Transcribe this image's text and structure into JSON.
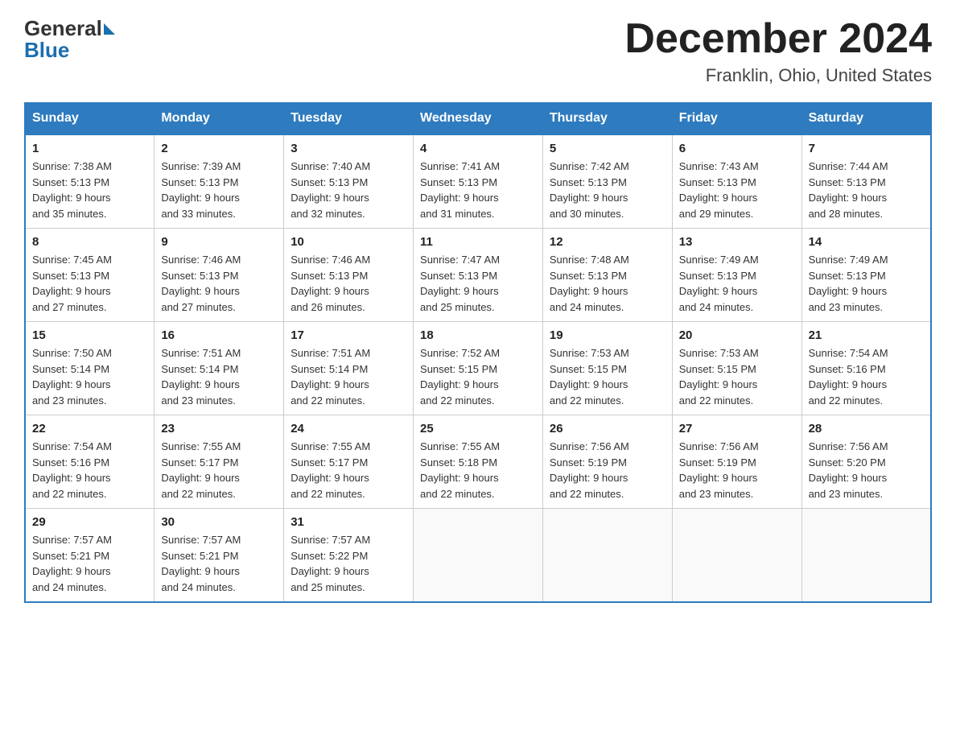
{
  "logo": {
    "general": "General",
    "blue": "Blue"
  },
  "title": "December 2024",
  "subtitle": "Franklin, Ohio, United States",
  "days": [
    "Sunday",
    "Monday",
    "Tuesday",
    "Wednesday",
    "Thursday",
    "Friday",
    "Saturday"
  ],
  "weeks": [
    [
      {
        "day": "1",
        "sunrise": "7:38 AM",
        "sunset": "5:13 PM",
        "daylight": "9 hours and 35 minutes."
      },
      {
        "day": "2",
        "sunrise": "7:39 AM",
        "sunset": "5:13 PM",
        "daylight": "9 hours and 33 minutes."
      },
      {
        "day": "3",
        "sunrise": "7:40 AM",
        "sunset": "5:13 PM",
        "daylight": "9 hours and 32 minutes."
      },
      {
        "day": "4",
        "sunrise": "7:41 AM",
        "sunset": "5:13 PM",
        "daylight": "9 hours and 31 minutes."
      },
      {
        "day": "5",
        "sunrise": "7:42 AM",
        "sunset": "5:13 PM",
        "daylight": "9 hours and 30 minutes."
      },
      {
        "day": "6",
        "sunrise": "7:43 AM",
        "sunset": "5:13 PM",
        "daylight": "9 hours and 29 minutes."
      },
      {
        "day": "7",
        "sunrise": "7:44 AM",
        "sunset": "5:13 PM",
        "daylight": "9 hours and 28 minutes."
      }
    ],
    [
      {
        "day": "8",
        "sunrise": "7:45 AM",
        "sunset": "5:13 PM",
        "daylight": "9 hours and 27 minutes."
      },
      {
        "day": "9",
        "sunrise": "7:46 AM",
        "sunset": "5:13 PM",
        "daylight": "9 hours and 27 minutes."
      },
      {
        "day": "10",
        "sunrise": "7:46 AM",
        "sunset": "5:13 PM",
        "daylight": "9 hours and 26 minutes."
      },
      {
        "day": "11",
        "sunrise": "7:47 AM",
        "sunset": "5:13 PM",
        "daylight": "9 hours and 25 minutes."
      },
      {
        "day": "12",
        "sunrise": "7:48 AM",
        "sunset": "5:13 PM",
        "daylight": "9 hours and 24 minutes."
      },
      {
        "day": "13",
        "sunrise": "7:49 AM",
        "sunset": "5:13 PM",
        "daylight": "9 hours and 24 minutes."
      },
      {
        "day": "14",
        "sunrise": "7:49 AM",
        "sunset": "5:13 PM",
        "daylight": "9 hours and 23 minutes."
      }
    ],
    [
      {
        "day": "15",
        "sunrise": "7:50 AM",
        "sunset": "5:14 PM",
        "daylight": "9 hours and 23 minutes."
      },
      {
        "day": "16",
        "sunrise": "7:51 AM",
        "sunset": "5:14 PM",
        "daylight": "9 hours and 23 minutes."
      },
      {
        "day": "17",
        "sunrise": "7:51 AM",
        "sunset": "5:14 PM",
        "daylight": "9 hours and 22 minutes."
      },
      {
        "day": "18",
        "sunrise": "7:52 AM",
        "sunset": "5:15 PM",
        "daylight": "9 hours and 22 minutes."
      },
      {
        "day": "19",
        "sunrise": "7:53 AM",
        "sunset": "5:15 PM",
        "daylight": "9 hours and 22 minutes."
      },
      {
        "day": "20",
        "sunrise": "7:53 AM",
        "sunset": "5:15 PM",
        "daylight": "9 hours and 22 minutes."
      },
      {
        "day": "21",
        "sunrise": "7:54 AM",
        "sunset": "5:16 PM",
        "daylight": "9 hours and 22 minutes."
      }
    ],
    [
      {
        "day": "22",
        "sunrise": "7:54 AM",
        "sunset": "5:16 PM",
        "daylight": "9 hours and 22 minutes."
      },
      {
        "day": "23",
        "sunrise": "7:55 AM",
        "sunset": "5:17 PM",
        "daylight": "9 hours and 22 minutes."
      },
      {
        "day": "24",
        "sunrise": "7:55 AM",
        "sunset": "5:17 PM",
        "daylight": "9 hours and 22 minutes."
      },
      {
        "day": "25",
        "sunrise": "7:55 AM",
        "sunset": "5:18 PM",
        "daylight": "9 hours and 22 minutes."
      },
      {
        "day": "26",
        "sunrise": "7:56 AM",
        "sunset": "5:19 PM",
        "daylight": "9 hours and 22 minutes."
      },
      {
        "day": "27",
        "sunrise": "7:56 AM",
        "sunset": "5:19 PM",
        "daylight": "9 hours and 23 minutes."
      },
      {
        "day": "28",
        "sunrise": "7:56 AM",
        "sunset": "5:20 PM",
        "daylight": "9 hours and 23 minutes."
      }
    ],
    [
      {
        "day": "29",
        "sunrise": "7:57 AM",
        "sunset": "5:21 PM",
        "daylight": "9 hours and 24 minutes."
      },
      {
        "day": "30",
        "sunrise": "7:57 AM",
        "sunset": "5:21 PM",
        "daylight": "9 hours and 24 minutes."
      },
      {
        "day": "31",
        "sunrise": "7:57 AM",
        "sunset": "5:22 PM",
        "daylight": "9 hours and 25 minutes."
      },
      null,
      null,
      null,
      null
    ]
  ],
  "labels": {
    "sunrise": "Sunrise:",
    "sunset": "Sunset:",
    "daylight": "Daylight:"
  }
}
